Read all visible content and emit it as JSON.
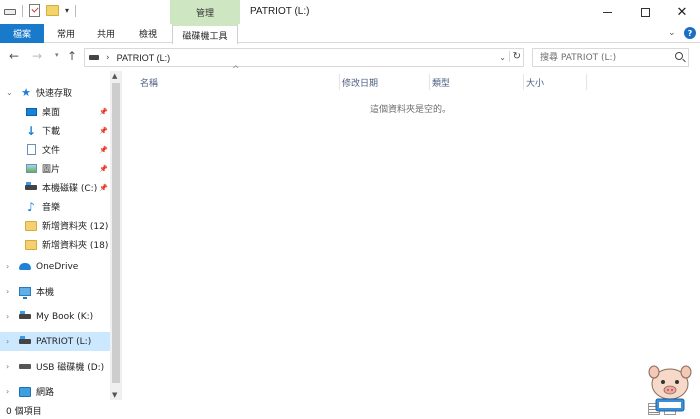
{
  "window": {
    "title": "PATRIOT (L:)",
    "context_group": "管理",
    "controls": [
      "minimize",
      "maximize",
      "close"
    ]
  },
  "ribbon": {
    "tabs": [
      {
        "label": "檔案",
        "active": true
      },
      {
        "label": "常用"
      },
      {
        "label": "共用"
      },
      {
        "label": "檢視"
      },
      {
        "label": "磁碟機工具"
      }
    ]
  },
  "address": {
    "path": "PATRIOT (L:)",
    "search_placeholder": "搜尋 PATRIOT (L:)"
  },
  "nav": {
    "quick_access": "快速存取",
    "items": [
      {
        "label": "桌面",
        "icon": "desktop-icon",
        "pinned": true
      },
      {
        "label": "下載",
        "icon": "download-icon",
        "pinned": true
      },
      {
        "label": "文件",
        "icon": "document-icon",
        "pinned": true
      },
      {
        "label": "圖片",
        "icon": "picture-icon",
        "pinned": true
      },
      {
        "label": "本機磁碟 (C:)",
        "icon": "drive-icon",
        "pinned": true
      },
      {
        "label": "音樂",
        "icon": "music-icon"
      },
      {
        "label": "新增資料夾 (12)",
        "icon": "folder-icon"
      },
      {
        "label": "新增資料夾 (18)",
        "icon": "folder-icon"
      }
    ],
    "roots": [
      {
        "label": "OneDrive",
        "icon": "onedrive-icon"
      },
      {
        "label": "本機",
        "icon": "computer-icon"
      },
      {
        "label": "My Book (K:)",
        "icon": "drive-icon"
      },
      {
        "label": "PATRIOT (L:)",
        "icon": "drive-icon",
        "selected": true
      },
      {
        "label": "USB 磁碟機 (D:)",
        "icon": "usb-drive-icon"
      },
      {
        "label": "網路",
        "icon": "network-icon"
      }
    ]
  },
  "content": {
    "columns": [
      "名稱",
      "修改日期",
      "類型",
      "大小"
    ],
    "empty_message": "這個資料夾是空的。"
  },
  "status": {
    "item_count": "0 個項目"
  },
  "colors": {
    "file_tab": "#1979ca",
    "context_tab": "#cfe6c3",
    "selection": "#cce8ff",
    "header_text": "#4d6082"
  }
}
